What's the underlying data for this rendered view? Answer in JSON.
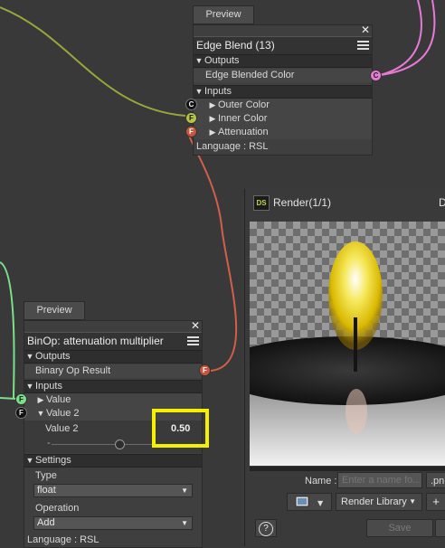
{
  "edge_blend": {
    "preview_label": "Preview",
    "title": "Edge Blend (13)",
    "close_glyph": "✕",
    "outputs_label": "Outputs",
    "output_item": "Edge Blended Color",
    "output_port": "C",
    "inputs_label": "Inputs",
    "inputs": [
      {
        "label": "Outer Color",
        "port": "C"
      },
      {
        "label": "Inner Color",
        "port": "F"
      },
      {
        "label": "Attenuation",
        "port": "F"
      }
    ],
    "language": "Language : RSL"
  },
  "binop": {
    "preview_label": "Preview",
    "title": "BinOp: attenuation multiplier",
    "close_glyph": "✕",
    "outputs_label": "Outputs",
    "output_item": "Binary Op Result",
    "output_port": "F",
    "inputs_label": "Inputs",
    "value_label": "Value",
    "value_port": "F",
    "value2_label": "Value 2",
    "value2_port": "F",
    "value2_field_label": "Value 2",
    "value2_value": "0.50",
    "value2_slider_fraction": 0.5,
    "settings_label": "Settings",
    "type_label": "Type",
    "type_value": "float",
    "operation_label": "Operation",
    "operation_value": "Add",
    "language": "Language : RSL"
  },
  "render_window": {
    "logo": "DS",
    "title": "Render(1/1)",
    "title_clipped": "D",
    "name_label": "Name :",
    "name_placeholder": "Enter a name fo...",
    "extension": ".pn",
    "render_library_label": "Render Library",
    "plus_label": "+",
    "help_label": "?",
    "save_label": "Save"
  },
  "colors": {
    "highlight": "#f5f000",
    "wire_yellow": "#9aa63a",
    "wire_red": "#d0604a",
    "wire_pink": "#e87ad7",
    "wire_green": "#7ae08a"
  }
}
